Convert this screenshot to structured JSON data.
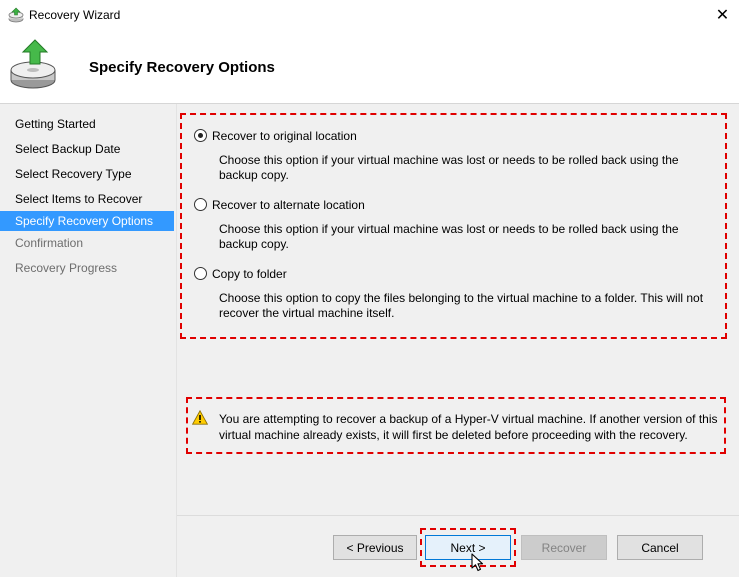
{
  "window": {
    "title": "Recovery Wizard",
    "close_glyph": "✕"
  },
  "header": {
    "title": "Specify Recovery Options"
  },
  "sidebar": {
    "items": [
      {
        "label": "Getting Started",
        "state": "done"
      },
      {
        "label": "Select Backup Date",
        "state": "done"
      },
      {
        "label": "Select Recovery Type",
        "state": "done"
      },
      {
        "label": "Select Items to Recover",
        "state": "done"
      },
      {
        "label": "Specify Recovery Options",
        "state": "active"
      },
      {
        "label": "Confirmation",
        "state": "disabled"
      },
      {
        "label": "Recovery Progress",
        "state": "disabled"
      }
    ]
  },
  "options": [
    {
      "label": "Recover to original location",
      "description": "Choose this option if your virtual machine was lost or needs to be rolled back using the backup copy.",
      "selected": true
    },
    {
      "label": "Recover to alternate location",
      "description": "Choose this option if your virtual machine was lost or needs to be rolled back using the backup copy.",
      "selected": false
    },
    {
      "label": "Copy to folder",
      "description": "Choose this option to copy the files belonging to the virtual machine to a folder. This will not recover the virtual machine itself.",
      "selected": false
    }
  ],
  "warning": {
    "text": "You are attempting to recover a backup of a Hyper-V virtual machine. If another version of this virtual machine already exists, it will first be deleted before proceeding with the recovery."
  },
  "buttons": {
    "previous": "< Previous",
    "next": "Next >",
    "recover": "Recover",
    "cancel": "Cancel"
  },
  "colors": {
    "accent": "#3399ff",
    "highlight": "#e00000",
    "panel": "#f0f0f0"
  },
  "icons": {
    "app": "recovery-wizard-icon",
    "header": "backup-drive-icon",
    "warning": "warning-triangle-icon",
    "cursor": "mouse-pointer-icon"
  }
}
